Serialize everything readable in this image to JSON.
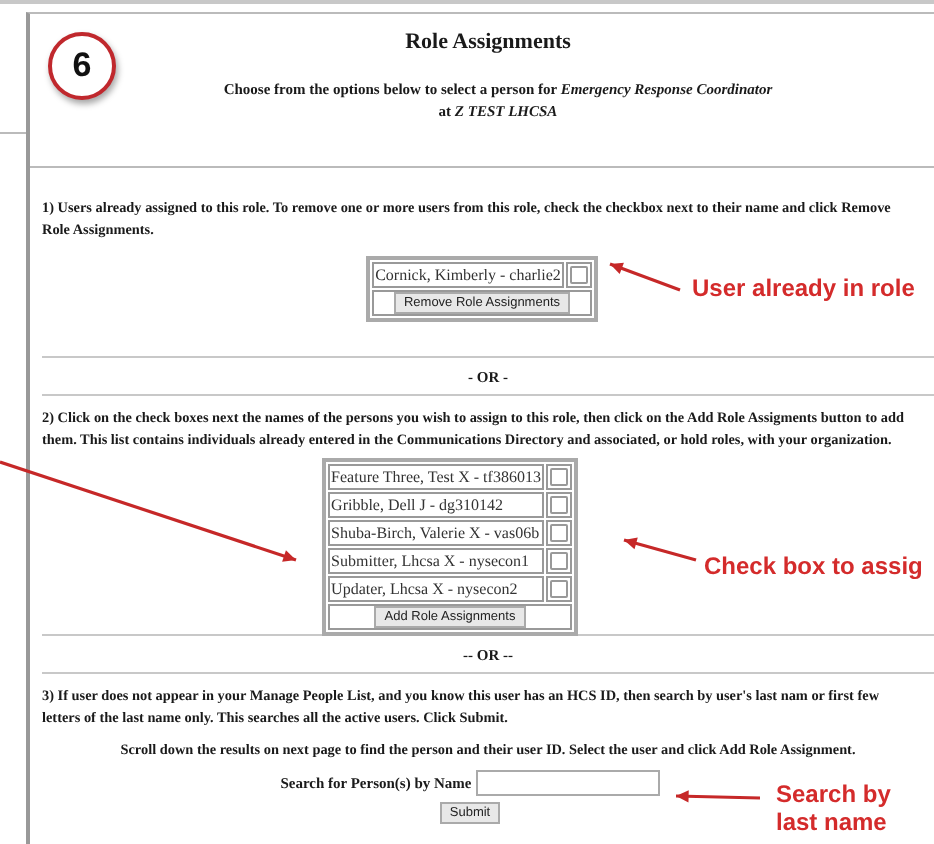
{
  "step_badge": "6",
  "title": "Role Assignments",
  "subtitle": "Choose from the options below to select a person for *Emergency Response Coordinator*",
  "subtitle_line2": "at *Z TEST LHCSA*",
  "section1": {
    "text": "1) Users already assigned to this role. To remove one or more users from this role, check the checkbox next to their name and click Remove Role Assignments.",
    "users": [
      {
        "name": "Cornick, Kimberly - charlie2",
        "checked": false
      }
    ],
    "button": "Remove Role Assignments"
  },
  "or_1": "- OR -",
  "section2": {
    "text": "2) Click on the check boxes next the names of the persons you wish to assign to this role, then click on the Add Role Assigments button to add them. This list contains individuals already entered in the Communications Directory and associated, or hold roles, with your organization.",
    "people": [
      {
        "name": "Feature Three, Test X - tf386013",
        "checked": false
      },
      {
        "name": "Gribble, Dell J - dg310142",
        "checked": false
      },
      {
        "name": "Shuba-Birch, Valerie X - vas06b",
        "checked": false
      },
      {
        "name": "Submitter, Lhcsa X - nysecon1",
        "checked": false
      },
      {
        "name": "Updater, Lhcsa X - nysecon2",
        "checked": false
      }
    ],
    "button": "Add Role Assignments"
  },
  "or_2": "-- OR --",
  "section3": {
    "text": "3) If user does not appear in your Manage People List, and you know this user has an HCS ID, then search by user's last nam or first few letters of the last name only. This searches all the active users. Click Submit.",
    "hint": "Scroll down the results on next page to find the person and their user ID. Select the user and click Add Role Assignment.",
    "search_label": "Search for Person(s) by Name",
    "button": "Submit"
  },
  "callouts": [
    {
      "text": "User already in role"
    },
    {
      "text": "Check box to assig"
    },
    {
      "text": "Search by last name"
    }
  ]
}
